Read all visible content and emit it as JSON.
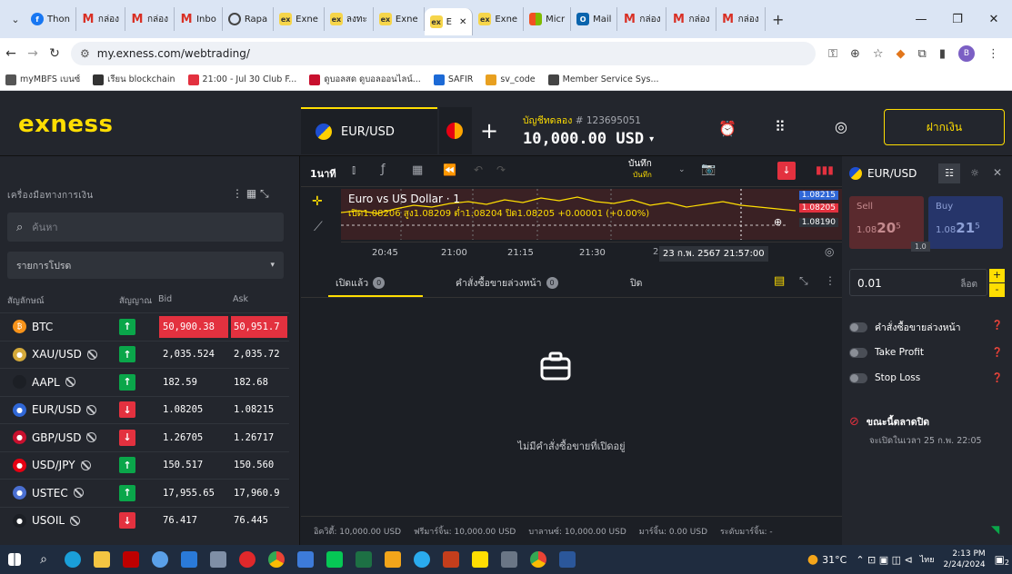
{
  "browser": {
    "tabs": [
      {
        "label": "Thon",
        "icon": "facebook-icon"
      },
      {
        "label": "กล่อง",
        "icon": "gmail-icon"
      },
      {
        "label": "กล่อง",
        "icon": "gmail-icon"
      },
      {
        "label": "Inbo",
        "icon": "gmail-icon"
      },
      {
        "label": "Rapa",
        "icon": "globe-icon"
      },
      {
        "label": "Exne",
        "icon": "exness-icon"
      },
      {
        "label": "ลงทะ",
        "icon": "exness-icon"
      },
      {
        "label": "Exne",
        "icon": "exness-icon"
      },
      {
        "label": "E",
        "icon": "exness-icon"
      },
      {
        "label": "Exne",
        "icon": "exness-icon"
      },
      {
        "label": "Micr",
        "icon": "microsoft-icon"
      },
      {
        "label": "Mail",
        "icon": "outlook-icon"
      },
      {
        "label": "กล่อง",
        "icon": "gmail-icon"
      },
      {
        "label": "กล่อง",
        "icon": "gmail-icon"
      },
      {
        "label": "กล่อง",
        "icon": "gmail-icon"
      }
    ],
    "new_tab": "+",
    "window_controls": {
      "minimize": "—",
      "restore": "❐",
      "close": "✕"
    },
    "url": "my.exness.com/webtrading/",
    "bookmarks": [
      "myMBFS เบนซ์",
      "เรียน blockchain",
      "21:00 - Jul 30 Club F...",
      "ดูบอลสด ดูบอลออนไลน์...",
      "SAFIR",
      "sv_code",
      "Member Service Sys..."
    ]
  },
  "app": {
    "logo": "exness",
    "symbol_tab": "EUR/USD",
    "add_tab": "+",
    "account_type": "บัญชีทดลอง",
    "account_number": "# 123695051",
    "balance": "10,000.00 USD",
    "deposit_label": "ฝากเงิน"
  },
  "instruments": {
    "title": "เครื่องมือทางการเงิน",
    "search_placeholder": "ค้นหา",
    "list_select": "รายการโปรด",
    "col_symbol": "สัญลักษณ์",
    "col_signal": "สัญญาณ",
    "col_bid": "Bid",
    "col_ask": "Ask",
    "rows": [
      {
        "symbol": "BTC",
        "dir": "up",
        "bid": "50,900.38",
        "ask": "50,951.7",
        "hl": true,
        "closed": false,
        "dot": "#f7931a",
        "glyph": "₿"
      },
      {
        "symbol": "XAU/USD",
        "dir": "up",
        "bid": "2,035.524",
        "ask": "2,035.72",
        "hl": false,
        "closed": true,
        "dot": "#d4a93a",
        "glyph": "●"
      },
      {
        "symbol": "AAPL",
        "dir": "up",
        "bid": "182.59",
        "ask": "182.68",
        "hl": false,
        "closed": true,
        "dot": "#1c1f25",
        "glyph": ""
      },
      {
        "symbol": "EUR/USD",
        "dir": "down",
        "bid": "1.08205",
        "ask": "1.08215",
        "hl": false,
        "closed": true,
        "dot": "#3067d6",
        "glyph": "●"
      },
      {
        "symbol": "GBP/USD",
        "dir": "down",
        "bid": "1.26705",
        "ask": "1.26717",
        "hl": false,
        "closed": true,
        "dot": "#c8102e",
        "glyph": "●"
      },
      {
        "symbol": "USD/JPY",
        "dir": "up",
        "bid": "150.517",
        "ask": "150.560",
        "hl": false,
        "closed": true,
        "dot": "#e60012",
        "glyph": "●"
      },
      {
        "symbol": "USTEC",
        "dir": "up",
        "bid": "17,955.65",
        "ask": "17,960.9",
        "hl": false,
        "closed": true,
        "dot": "#4a6fd1",
        "glyph": "●"
      },
      {
        "symbol": "USOIL",
        "dir": "down",
        "bid": "76.417",
        "ask": "76.445",
        "hl": false,
        "closed": true,
        "dot": "#1c1f25",
        "glyph": "●"
      }
    ]
  },
  "chart": {
    "timeframe": "1นาที",
    "save_label": "บันทึก",
    "save_sub": "บันทึก",
    "title": "Euro vs US Dollar · 1",
    "ohlc": "เปิด1.08206 สูง1.08209 ต่ำ1.08204 ปิด1.08205 +0.00001 (+0.00%)",
    "price_top": "1.08215",
    "price_current": "1.08205",
    "price_low": "1.08190",
    "times": [
      "20:45",
      "21:00",
      "21:15",
      "21:30"
    ],
    "crosshair_time": "23 ก.พ. 2567  21:57:00",
    "crosshair_prefix": "2"
  },
  "orders": {
    "tab_open": "เปิดแล้ว",
    "tab_open_count": "0",
    "tab_pending": "คำสั่งซื้อขายล่วงหน้า",
    "tab_pending_count": "0",
    "tab_closed": "ปิด",
    "empty": "ไม่มีคำสั่งซื้อขายที่เปิดอยู่",
    "equity": "อิควิตี้: 10,000.00 USD",
    "free_margin": "ฟรีมาร์จิ้น: 10,000.00 USD",
    "balance": "บาลานซ์: 10,000.00 USD",
    "margin": "มาร์จิ้น: 0.00 USD",
    "margin_level": "ระดับมาร์จิ้น: -"
  },
  "trade": {
    "symbol": "EUR/USD",
    "sell_label": "Sell",
    "sell_prefix": "1.08",
    "sell_big": "20",
    "sell_sup": "5",
    "buy_label": "Buy",
    "buy_prefix": "1.08",
    "buy_big": "21",
    "buy_sup": "5",
    "spread": "1.0",
    "volume": "0.01",
    "unit": "ล็อต",
    "pending_label": "คำสั่งซื้อขายล่วงหน้า",
    "tp_label": "Take Profit",
    "sl_label": "Stop Loss",
    "market_closed": "ขณะนี้ตลาดปิด",
    "reopen": "จะเปิดในเวลา 25 ก.พ. 22:05"
  },
  "taskbar": {
    "weather": "31°C",
    "lang": "ไทย",
    "time": "2:13 PM",
    "date": "2/24/2024",
    "notif": "2"
  }
}
